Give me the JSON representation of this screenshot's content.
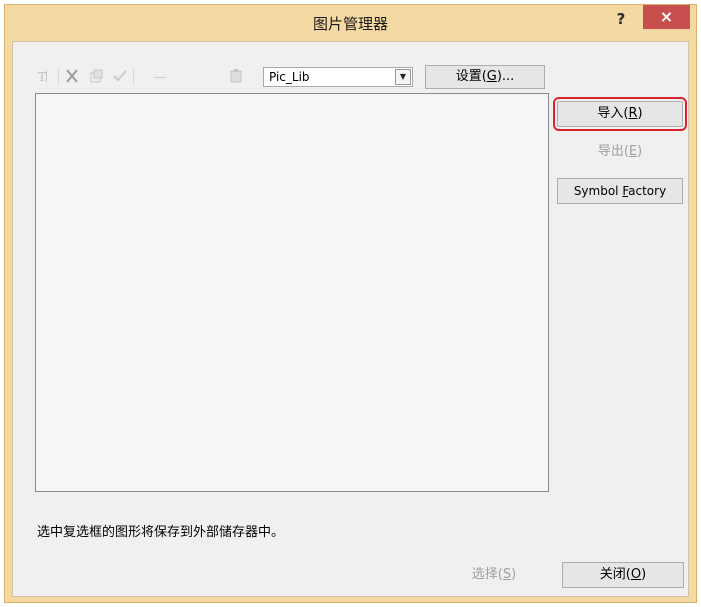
{
  "window": {
    "title": "图片管理器",
    "help_label": "?",
    "close_label": "×"
  },
  "toolbar": {
    "icons": [
      "text-tool-icon",
      "cut-icon",
      "copy-icon",
      "check-icon",
      "line-icon",
      "paste-icon"
    ],
    "library_select": {
      "value": "Pic_Lib"
    },
    "settings_label_pre": "设置(",
    "settings_label_key": "G",
    "settings_label_post": ")..."
  },
  "side_buttons": {
    "import_pre": "导入(",
    "import_key": "R",
    "import_post": ")",
    "export_pre": "导出(",
    "export_key": "E",
    "export_post": ")",
    "symbol_pre": "Symbol ",
    "symbol_key": "F",
    "symbol_post": "actory"
  },
  "status": {
    "message": "选中复选框的图形将保存到外部储存器中。"
  },
  "footer": {
    "select_pre": "选择(",
    "select_key": "S",
    "select_post": ")",
    "close_pre": "关闭(",
    "close_key": "O",
    "close_post": ")"
  },
  "colors": {
    "frame": "#f5d9a3",
    "close_button": "#c7504f",
    "highlight": "#d9232d",
    "client": "#f0f0f0"
  }
}
